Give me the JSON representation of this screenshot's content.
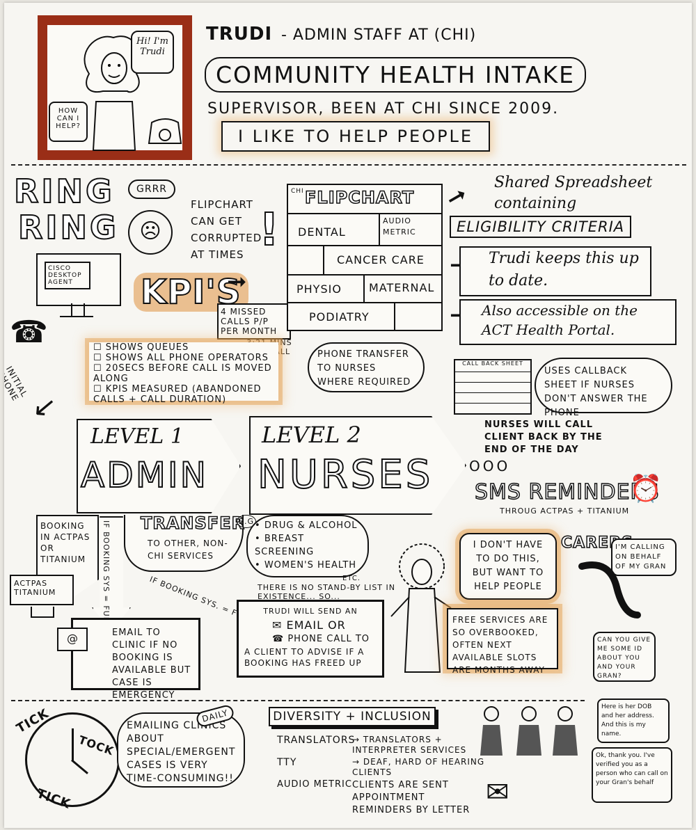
{
  "header": {
    "name": "TRUDI",
    "role": "- ADMIN STAFF AT (CHI)",
    "dept": "COMMUNITY HEALTH INTAKE",
    "since": "SUPERVISOR, BEEN AT CHI SINCE 2009.",
    "quote": "I LIKE TO HELP PEOPLE",
    "bubble_hi": "Hi! I'm Trudi",
    "bubble_help": "HOW CAN I HELP?"
  },
  "ring": {
    "line1": "RING",
    "line2": "RING",
    "grrr": "GRRR",
    "complaint": "FLIPCHART CAN GET CORRUPTED AT TIMES",
    "excl": "!"
  },
  "cisco": {
    "label": "CISCO DESKTOP AGENT"
  },
  "kpi": {
    "title": "KPI's",
    "missed": "4 MISSED CALLS P/P PER MONTH",
    "mins": "3:21 MINS PER CALL",
    "items": [
      "SHOWS QUEUES",
      "SHOWS ALL PHONE OPERATORS",
      "20SECS BEFORE CALL IS MOVED ALONG",
      "KPIs MEASURED (ABANDONED CALLS + CALL DURATION)"
    ]
  },
  "initial_call": "INITIAL PHONE CALL",
  "flipchart": {
    "tag": "CHI",
    "title": "FLIPCHART",
    "cells": [
      "DENTAL",
      "AUDIO METRIC",
      "CANCER CARE",
      "PHYSIO",
      "MATERNAL",
      "PODIATRY"
    ]
  },
  "notes": {
    "spreadsheet": "Shared Spreadsheet containing",
    "eligibility": "ELIGIBILITY CRITERIA",
    "trudi_keeps": "Trudi keeps this up to date.",
    "portal1": "Also accessible on the",
    "portal2": "ACT Health Portal."
  },
  "transfer_note": "PHONE TRANSFER TO NURSES WHERE REQUIRED",
  "callback": {
    "sheet": "CALL BACK SHEET",
    "uses": "USES CALLBACK SHEET IF NURSES DON'T ANSWER THE PHONE",
    "nurses": "NURSES WILL CALL CLIENT BACK BY THE END OF THE DAY"
  },
  "level1": {
    "level": "LEVEL 1",
    "name": "ADMIN"
  },
  "level2": {
    "level": "LEVEL 2",
    "name": "NURSES"
  },
  "ooo": "OOO",
  "sms": {
    "title": "SMS REMINDERS",
    "sub": "THROUG ACTPAS + TITANIUM"
  },
  "booking": {
    "text": "BOOKING IN ACTPAS OR TITANIUM",
    "system": "ACTPAS TITANIUM",
    "if_full": "IF BOOKING SYS = FULL"
  },
  "transfer": {
    "title": "TRANSFER",
    "desc": "TO OTHER, NON-CHI SERVICES",
    "eg": "E.G",
    "services": [
      "DRUG & ALCOHOL",
      "BREAST SCREENING",
      "WOMEN'S HEALTH"
    ],
    "etc": "ETC."
  },
  "trudi_says": "I DON'T HAVE TO DO THIS, BUT WANT TO HELP PEOPLE",
  "free_services": "FREE SERVICES ARE SO OVERBOOKED, OFTEN NEXT AVAILABLE SLOTS ARE MONTHS AWAY",
  "standby": {
    "if_full": "IF BOOKING SYS. = FULL",
    "head": "THERE IS NO STAND-BY LIST IN EXISTENCE... SO...",
    "will": "TRUDI WILL SEND AN",
    "email": "EMAIL OR",
    "phone": "PHONE CALL TO",
    "client": "A CLIENT TO ADVISE IF A BOOKING HAS FREED UP"
  },
  "email_clinic": "EMAIL TO CLINIC IF NO BOOKING IS AVAILABLE BUT CASE IS EMERGENCY",
  "carers": {
    "title": "CARERS",
    "q1": "I'M CALLING ON BEHALF OF MY GRAN",
    "q2": "CAN YOU GIVE ME SOME ID ABOUT YOU AND YOUR GRAN?",
    "q3": "Here is her DOB and her address. And this is my name.",
    "q4": "Ok, thank you. I've verified you as a person who can call on your Gran's behalf"
  },
  "tick": {
    "tick": "TICK",
    "tock": "TOCK",
    "tick2": "TICK"
  },
  "emailing": {
    "text": "EMAILING CLINICS ABOUT SPECIAL/EMERGENT CASES IS VERY TIME-CONSUMING!!",
    "daily": "DAILY"
  },
  "diversity": {
    "title": "DIVERSITY + INCLUSION",
    "rows": [
      {
        "left": "TRANSLATORS",
        "right": "TRANSLATORS + INTERPRETER SERVICES"
      },
      {
        "left": "TTY",
        "right": "DEAF, HARD OF HEARING CLIENTS"
      },
      {
        "left": "AUDIO METRIC",
        "right": "CLIENTS ARE SENT APPOINTMENT REMINDERS BY LETTER"
      }
    ]
  },
  "colors": {
    "accent": "#e3a15a",
    "frame": "#9a2e17",
    "ink": "#111111"
  }
}
